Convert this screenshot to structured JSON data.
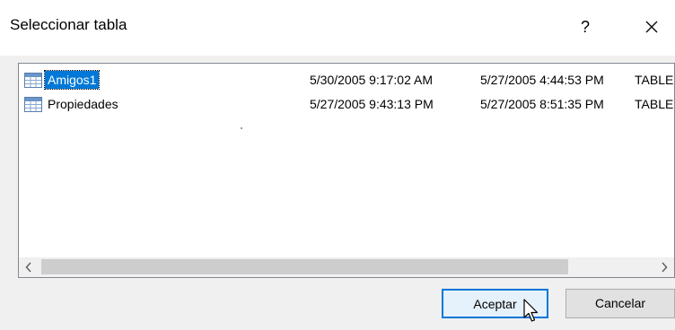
{
  "dialog": {
    "title": "Seleccionar tabla",
    "help_label": "?"
  },
  "table_list": {
    "rows": [
      {
        "name": "Amigos1",
        "modified": "5/30/2005 9:17:02 AM",
        "created": "5/27/2005 4:44:53 PM",
        "type": "TABLE",
        "selected": true
      },
      {
        "name": "Propiedades",
        "modified": "5/27/2005 9:43:13 PM",
        "created": "5/27/2005 8:51:35 PM",
        "type": "TABLE",
        "selected": false
      }
    ]
  },
  "buttons": {
    "ok_label": "Aceptar",
    "cancel_label": "Cancelar"
  },
  "colors": {
    "selection": "#0078d7",
    "default_button_border": "#0078d7"
  },
  "icons": {
    "row_icon": "table-icon",
    "close": "close-icon",
    "scroll_left": "chevron-left-icon",
    "scroll_right": "chevron-right-icon"
  }
}
